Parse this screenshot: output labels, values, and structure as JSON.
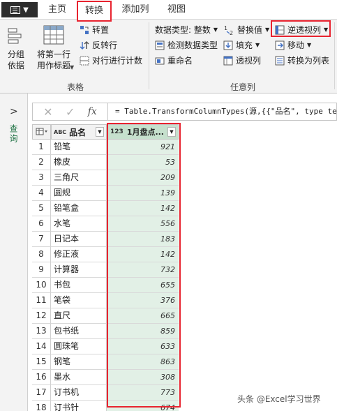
{
  "tabs": {
    "home": "主页",
    "transform": "转换",
    "add_column": "添加列",
    "view": "视图"
  },
  "ribbon": {
    "table_group": {
      "label": "表格",
      "group_by": "分组\n依据",
      "first_row_header": "将第一行\n用作标题",
      "transpose": "转置",
      "reverse_rows": "反转行",
      "count_rows": "对行进行计数"
    },
    "any_column_group": {
      "label": "任意列",
      "data_type": "数据类型: 整数",
      "detect_type": "检测数据类型",
      "rename": "重命名",
      "replace_values": "替换值",
      "fill": "填充",
      "pivot_column": "透视列",
      "unpivot_column": "逆透视列",
      "move": "移动",
      "convert_to_list": "转换为列表"
    }
  },
  "left_nav": {
    "label": "查询"
  },
  "formula_bar": {
    "fx": "fx",
    "formula": "= Table.TransformColumnTypes(源,{{\"品名\", type te"
  },
  "table": {
    "columns": [
      {
        "type_label": "ABC",
        "name": "品名"
      },
      {
        "type_label": "123",
        "name": "1月盘点..."
      }
    ],
    "rows": [
      {
        "n": "1",
        "name": "铅笔",
        "value": "921"
      },
      {
        "n": "2",
        "name": "橡皮",
        "value": "53"
      },
      {
        "n": "3",
        "name": "三角尺",
        "value": "209"
      },
      {
        "n": "4",
        "name": "圆规",
        "value": "139"
      },
      {
        "n": "5",
        "name": "铅笔盒",
        "value": "142"
      },
      {
        "n": "6",
        "name": "水笔",
        "value": "556"
      },
      {
        "n": "7",
        "name": "日记本",
        "value": "183"
      },
      {
        "n": "8",
        "name": "修正液",
        "value": "142"
      },
      {
        "n": "9",
        "name": "计算器",
        "value": "732"
      },
      {
        "n": "10",
        "name": "书包",
        "value": "655"
      },
      {
        "n": "11",
        "name": "笔袋",
        "value": "376"
      },
      {
        "n": "12",
        "name": "直尺",
        "value": "665"
      },
      {
        "n": "13",
        "name": "包书纸",
        "value": "859"
      },
      {
        "n": "14",
        "name": "圆珠笔",
        "value": "633"
      },
      {
        "n": "15",
        "name": "钢笔",
        "value": "863"
      },
      {
        "n": "16",
        "name": "墨水",
        "value": "308"
      },
      {
        "n": "17",
        "name": "订书机",
        "value": "773"
      },
      {
        "n": "18",
        "name": "订书针",
        "value": "674"
      }
    ]
  },
  "watermark": "头条 @Excel学习世界",
  "colors": {
    "highlight": "#e8232f",
    "selected_column": "#e2f0e6",
    "selected_header": "#c6e0cd",
    "accent_green": "#217346"
  }
}
